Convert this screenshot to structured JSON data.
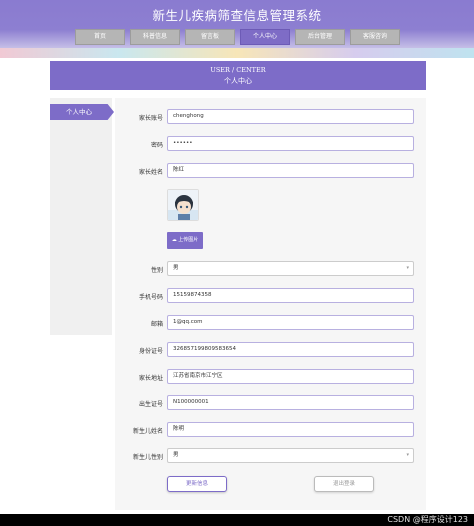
{
  "header": {
    "title": "新生儿疾病筛查信息管理系统"
  },
  "nav": {
    "items": [
      {
        "label": "首页"
      },
      {
        "label": "科普信息"
      },
      {
        "label": "留言板"
      },
      {
        "label": "个人中心"
      },
      {
        "label": "后台管理"
      },
      {
        "label": "客服咨询"
      }
    ],
    "active": "个人中心"
  },
  "banner": {
    "en": "USER / CENTER",
    "cn": "个人中心"
  },
  "sidebar": {
    "items": [
      {
        "label": "个人中心"
      }
    ]
  },
  "form": {
    "account": {
      "label": "家长账号",
      "value": "chenghong"
    },
    "password": {
      "label": "密码",
      "value": "••••••"
    },
    "parent_name": {
      "label": "家长姓名",
      "value": "陈红"
    },
    "upload_label": "上传图片",
    "gender": {
      "label": "性别",
      "value": "男"
    },
    "phone": {
      "label": "手机号码",
      "value": "15159874358"
    },
    "email": {
      "label": "邮箱",
      "value": "1@qq.com"
    },
    "id_card": {
      "label": "身份证号",
      "value": "326857199809583654"
    },
    "address": {
      "label": "家长地址",
      "value": "江苏省南京市江宁区"
    },
    "birth_cert": {
      "label": "出生证号",
      "value": "N100000001"
    },
    "baby_name": {
      "label": "新生儿姓名",
      "value": "陈明"
    },
    "baby_gender": {
      "label": "新生儿性别",
      "value": "男"
    }
  },
  "buttons": {
    "update": "更新信息",
    "logout": "退出登录"
  },
  "watermark": "CSDN @程序设计123",
  "colors": {
    "accent": "#7d6cc8",
    "nav_inactive": "#b5b5b5"
  }
}
